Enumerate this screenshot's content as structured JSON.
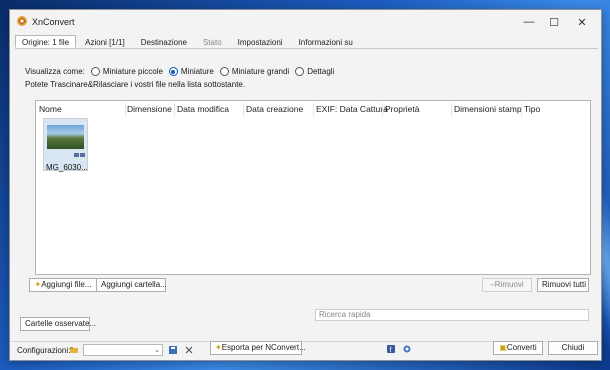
{
  "window": {
    "title": "XnConvert",
    "controls": {
      "minimize": "—",
      "maximize": "☐",
      "close": "✕"
    }
  },
  "tabs": [
    {
      "label": "Origine: 1 file",
      "active": true,
      "disabled": false
    },
    {
      "label": "Azioni [1/1]",
      "active": false,
      "disabled": false
    },
    {
      "label": "Destinazione",
      "active": false,
      "disabled": false
    },
    {
      "label": "Stato",
      "active": false,
      "disabled": true
    },
    {
      "label": "Impostazioni",
      "active": false,
      "disabled": false
    },
    {
      "label": "Informazioni su",
      "active": false,
      "disabled": false
    }
  ],
  "view": {
    "label": "Visualizza come:",
    "options": [
      {
        "label": "Miniature piccole",
        "checked": false
      },
      {
        "label": "Miniature",
        "checked": true
      },
      {
        "label": "Miniature grandi",
        "checked": false
      },
      {
        "label": "Dettagli",
        "checked": false
      }
    ]
  },
  "hint": "Potete Trascinare&Rilasciare i vostri file nella lista sottostante.",
  "list": {
    "columns": [
      "Nome",
      "Dimensione",
      "Data modifica",
      "Data creazione",
      "EXIF: Data Cattura",
      "Proprietà",
      "Dimensioni stamp",
      "Tipo"
    ],
    "files": [
      {
        "name": "MG_6030..."
      }
    ]
  },
  "buttons": {
    "add_files": "Aggiungi file...",
    "add_folder": "Aggiungi cartella...",
    "remove": "Rimuovi",
    "remove_all": "Rimuovi tutti",
    "watched_folders": "Cartelle osservate...",
    "export": "Esporta per NConvert...",
    "convert": "Converti",
    "close": "Chiudi"
  },
  "search": {
    "placeholder": "Ricerca rapida"
  },
  "config": {
    "label": "Configurazioni:",
    "value": ""
  },
  "colors": {
    "accent": "#0a5cbf",
    "window_bg": "#f3f3f3"
  }
}
